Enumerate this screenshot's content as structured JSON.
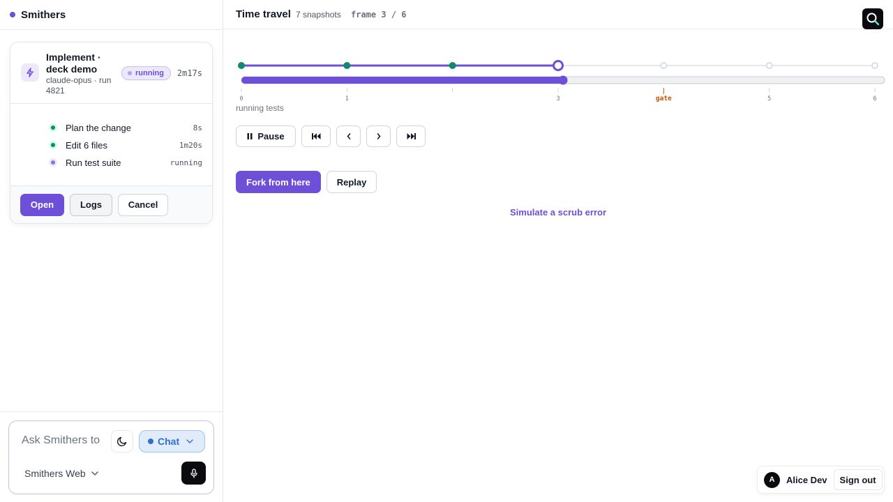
{
  "app": {
    "name": "Smithers"
  },
  "run": {
    "title": "Implement · deck demo",
    "subtitle": "claude-opus · run 4821",
    "status": "running",
    "elapsed": "2m17s",
    "steps": [
      {
        "label": "Plan the change",
        "time": "8s",
        "state": "done"
      },
      {
        "label": "Edit 6 files",
        "time": "1m20s",
        "state": "done"
      },
      {
        "label": "Run test suite",
        "time": "running",
        "state": "running"
      }
    ],
    "actions": {
      "open": "Open",
      "logs": "Logs",
      "cancel": "Cancel"
    }
  },
  "composer": {
    "placeholder": "Ask Smithers to",
    "mode": "Chat",
    "workspace": "Smithers Web"
  },
  "time_travel": {
    "title": "Time travel",
    "snapshots": "7 snapshots",
    "frame": "frame 3 / 6",
    "current_frame": 3,
    "total_frames": 6,
    "scrub_progress": 0.5,
    "tick_labels": [
      "0",
      "1",
      "",
      "3",
      "gate",
      "5",
      "6"
    ],
    "status": "running tests",
    "controls": {
      "pause": "Pause"
    },
    "fork": "Fork from here",
    "replay": "Replay",
    "simulate": "Simulate a scrub error"
  },
  "colors": {
    "accent": "#6d4fd8",
    "done": "#0f8a6e",
    "gate": "#c2570c",
    "chat": "#2f6fd0"
  },
  "user": {
    "initial": "A",
    "name": "Alice Dev",
    "signout": "Sign out"
  }
}
